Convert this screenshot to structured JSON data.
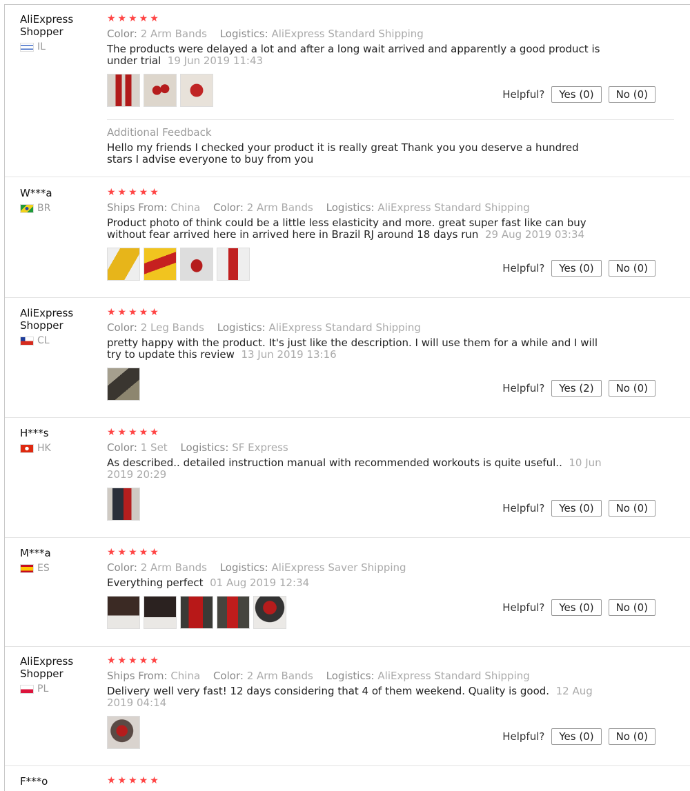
{
  "labels": {
    "helpful": "Helpful?",
    "ships_from": "Ships From:",
    "color": "Color:",
    "logistics": "Logistics:",
    "additional_feedback": "Additional Feedback"
  },
  "reviews": [
    {
      "user": [
        "AliExpress",
        "Shopper"
      ],
      "country": "IL",
      "stars": "★★★★★",
      "color": "2 Arm Bands",
      "logistics": "AliExpress Standard Shipping",
      "text": "The products were delayed a lot and after a long wait arrived and apparently a good product is under trial",
      "date": "19 Jun 2019 11:43",
      "yes": "Yes (0)",
      "no": "No (0)",
      "feedback": "Hello my friends I checked your product it is really great Thank you you deserve a hundred stars I advise everyone to buy from you"
    },
    {
      "user": [
        "W***a"
      ],
      "country": "BR",
      "stars": "★★★★★",
      "ships_from": "China",
      "color": "2 Arm Bands",
      "logistics": "AliExpress Standard Shipping",
      "text": "Product photo of think could be a little less elasticity and more. great super fast like can buy without fear arrived here in arrived here in Brazil RJ around 18 days run",
      "date": "29 Aug 2019 03:34",
      "yes": "Yes (0)",
      "no": "No (0)"
    },
    {
      "user": [
        "AliExpress",
        "Shopper"
      ],
      "country": "CL",
      "stars": "★★★★★",
      "color": "2 Leg Bands",
      "logistics": "AliExpress Standard Shipping",
      "text": "pretty happy with the product. It's just like the description. I will use them for a while and I will try to update this review",
      "date": "13 Jun 2019 13:16",
      "yes": "Yes (2)",
      "no": "No (0)"
    },
    {
      "user": [
        "H***s"
      ],
      "country": "HK",
      "stars": "★★★★★",
      "color": "1 Set",
      "logistics": "SF Express",
      "text": "As described.. detailed instruction manual with recommended workouts is quite useful..",
      "date": "10 Jun 2019 20:29",
      "yes": "Yes (0)",
      "no": "No (0)"
    },
    {
      "user": [
        "M***a"
      ],
      "country": "ES",
      "stars": "★★★★★",
      "color": "2 Arm Bands",
      "logistics": "AliExpress Saver Shipping",
      "text": "Everything perfect",
      "date": "01 Aug 2019 12:34",
      "yes": "Yes (0)",
      "no": "No (0)"
    },
    {
      "user": [
        "AliExpress",
        "Shopper"
      ],
      "country": "PL",
      "stars": "★★★★★",
      "ships_from": "China",
      "color": "2 Arm Bands",
      "logistics": "AliExpress Standard Shipping",
      "text": "Delivery well very fast! 12 days considering that 4 of them weekend. Quality is good.",
      "date": "12 Aug 2019 04:14",
      "yes": "Yes (0)",
      "no": "No (0)"
    },
    {
      "user": [
        "F***o"
      ],
      "stars": "★★★★★"
    }
  ]
}
